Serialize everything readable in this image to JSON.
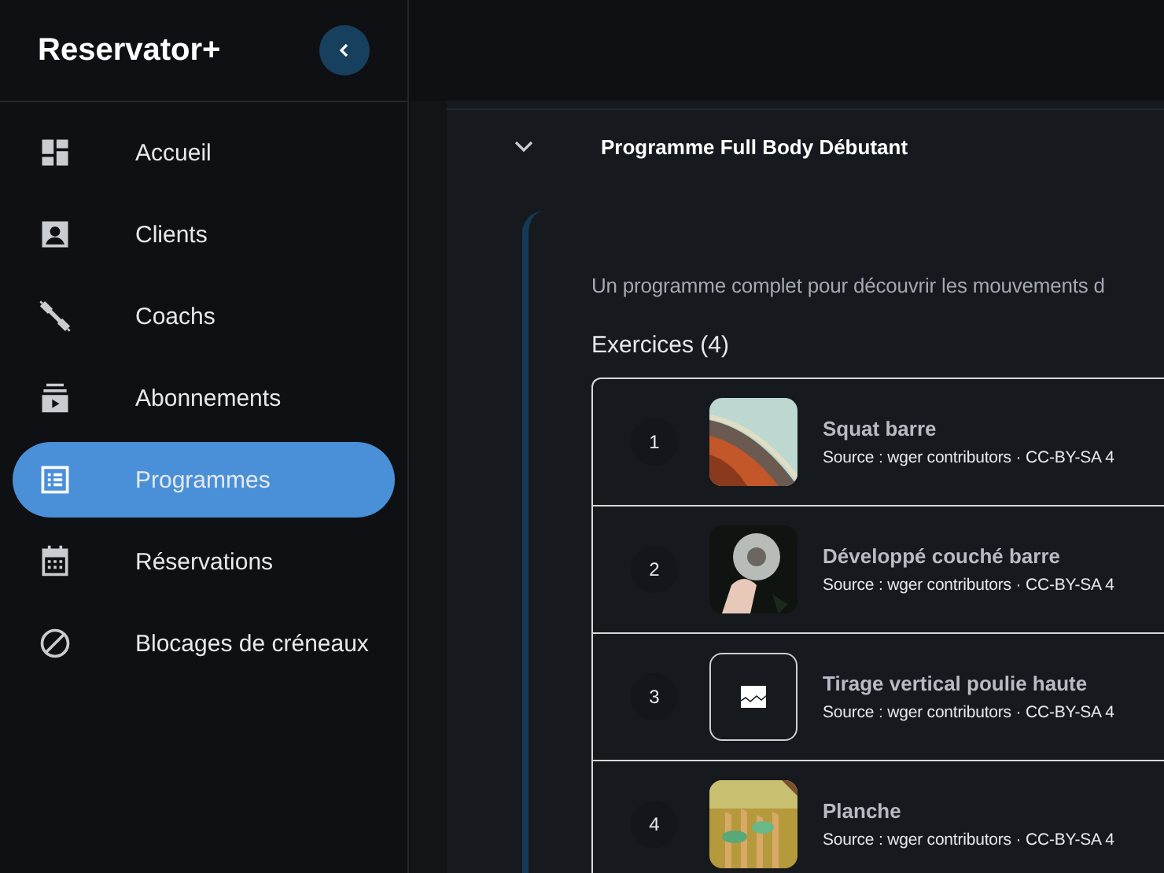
{
  "sidebar": {
    "brand": "Reservator+",
    "items": [
      {
        "label": "Accueil",
        "selected": false
      },
      {
        "label": "Clients",
        "selected": false
      },
      {
        "label": "Coachs",
        "selected": false
      },
      {
        "label": "Abonnements",
        "selected": false
      },
      {
        "label": "Programmes",
        "selected": true
      },
      {
        "label": "Réservations",
        "selected": false
      },
      {
        "label": "Blocages de créneaux",
        "selected": false
      }
    ]
  },
  "program": {
    "title": "Programme Full Body Débutant",
    "expanded": true,
    "description": "Un programme complet pour découvrir les mouvements d",
    "exercises_heading": "Exercices (4)",
    "exercises": [
      {
        "number": "1",
        "name": "Squat barre",
        "source": "Source : wger contributors · CC-BY-SA 4",
        "kind": "picture"
      },
      {
        "number": "2",
        "name": "Développé couché barre",
        "source": "Source : wger contributors · CC-BY-SA 4",
        "kind": "picture"
      },
      {
        "number": "3",
        "name": "Tirage vertical poulie haute",
        "source": "Source : wger contributors · CC-BY-SA 4",
        "kind": "placeholder"
      },
      {
        "number": "4",
        "name": "Planche",
        "source": "Source : wger contributors · CC-BY-SA 4",
        "kind": "picture"
      }
    ]
  }
}
